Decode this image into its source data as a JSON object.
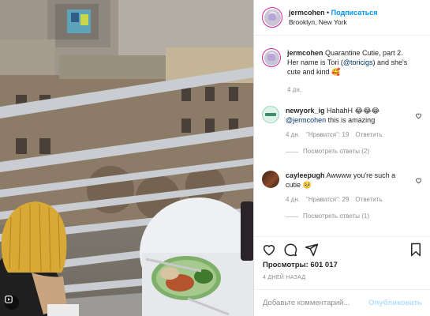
{
  "post": {
    "username": "jermcohen",
    "separator": " • ",
    "follow_label": "Подписаться",
    "location": "Brooklyn, New York"
  },
  "caption": {
    "username": "jermcohen",
    "text_before": " Quarantine Cutie, part 2. Her name is Tori (",
    "mention": "@toricigs",
    "text_after": ") and she's cute and kind 🥰",
    "time": "4 дн."
  },
  "comments": [
    {
      "username": "newyork_ig",
      "text_before": " HahahH 😂😂😂 ",
      "mention": "@jermcohen",
      "text_after": " this is amazing",
      "time": "4 дн.",
      "likes": "\"Нравится\": 19",
      "reply_label": "Ответить",
      "view_replies": "Посмотреть ответы (2)"
    },
    {
      "username": "cayleepugh",
      "text_before": " Awwww you're such a cutie ",
      "mention": "",
      "text_after": "🥺",
      "time": "4 дн.",
      "likes": "\"Нравится\": 29",
      "reply_label": "Ответить",
      "view_replies": "Посмотреть ответы (1)"
    }
  ],
  "stats": {
    "views": "Просмотры: 601 017",
    "posted_ago": "4 ДНЕЙ НАЗАД"
  },
  "comment_box": {
    "placeholder": "Добавьте комментарий...",
    "publish_label": "Опубликовать"
  },
  "icons": {
    "like": "heart-icon",
    "comment": "comment-icon",
    "share": "share-icon",
    "save": "bookmark-icon",
    "media_type": "reel-icon",
    "emoji": "smiley-icon"
  },
  "colors": {
    "link": "#0095f6",
    "mention": "#00376b",
    "muted": "#8e8e8e",
    "publish_disabled": "#b2dffc"
  }
}
